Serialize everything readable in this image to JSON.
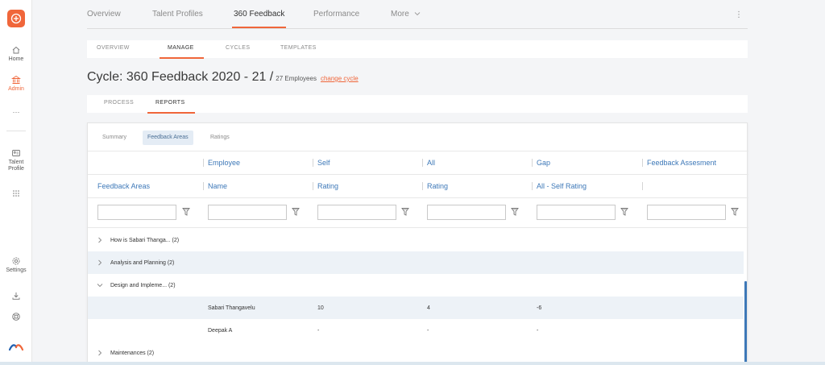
{
  "rail": {
    "items": [
      {
        "label": "Home",
        "icon": "home-icon"
      },
      {
        "label": "Admin",
        "icon": "bank-icon"
      },
      {
        "label": "···",
        "icon": "more-icon"
      },
      {
        "label": "Talent Profile",
        "icon": "profile-card-icon"
      },
      {
        "label": "",
        "icon": "apps-grid-icon"
      },
      {
        "label": "Settings",
        "icon": "gear-icon"
      },
      {
        "label": "",
        "icon": "download-icon"
      },
      {
        "label": "",
        "icon": "help-ring-icon"
      }
    ],
    "accent": "#f0663a"
  },
  "topnav": {
    "tabs": [
      "Overview",
      "Talent Profiles",
      "360 Feedback",
      "Performance",
      "More"
    ],
    "active": "360 Feedback"
  },
  "subnav": {
    "tabs": [
      "OVERVIEW",
      "MANAGE",
      "CYCLES",
      "TEMPLATES"
    ],
    "active": "MANAGE"
  },
  "cycle": {
    "title": "Cycle: 360 Feedback 2020 - 21 /",
    "employees": "27 Employees",
    "change_link": "change cycle"
  },
  "subnav2": {
    "tabs": [
      "PROCESS",
      "REPORTS"
    ],
    "active": "REPORTS"
  },
  "report": {
    "pills": [
      "Summary",
      "Feedback Areas",
      "Ratings"
    ],
    "active_pill": "Feedback Areas",
    "header_top": [
      "",
      "Employee",
      "Self",
      "All",
      "Gap",
      "Feedback Assesment"
    ],
    "header_bottom": [
      "Feedback Areas",
      "Name",
      "Rating",
      "Rating",
      "All - Self Rating",
      ""
    ],
    "groups": [
      {
        "label": "How is Sabari Thanga... (2)",
        "expanded": false,
        "shaded": false
      },
      {
        "label": "Analysis and Planning (2)",
        "expanded": false,
        "shaded": true
      },
      {
        "label": "Design and Impleme... (2)",
        "expanded": true,
        "shaded": false
      },
      {
        "label": "Maintenances (2)",
        "expanded": false,
        "shaded": false
      }
    ],
    "detail_rows": [
      {
        "name": "Sabari Thangavelu",
        "self": "10",
        "all": "4",
        "gap": "-6"
      },
      {
        "name": "Deepak A",
        "self": "-",
        "all": "-",
        "gap": "-"
      }
    ],
    "header_color": "#3d78b8"
  }
}
